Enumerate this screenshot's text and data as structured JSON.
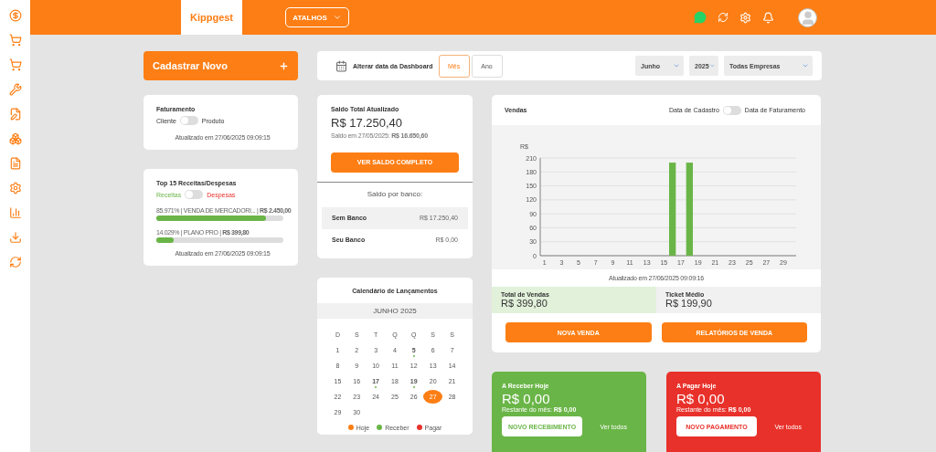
{
  "header": {
    "brand": "Kippgest",
    "shortcuts": "ATALHOS"
  },
  "new_button": {
    "label": "Cadastrar Novo"
  },
  "date_bar": {
    "label": "Alterar data da Dashboard",
    "periods": [
      {
        "label": "Mês",
        "selected": true
      },
      {
        "label": "Ano",
        "selected": false
      }
    ],
    "selects": [
      {
        "value": "Junho"
      },
      {
        "value": "2025"
      },
      {
        "value": "Todas Empresas"
      }
    ]
  },
  "faturamento": {
    "title": "Faturamento",
    "left": "Cliente",
    "right": "Produto",
    "on": false,
    "updated": "Atualizado em 27/06/2025 09:09:15"
  },
  "top15": {
    "title": "Top 15 Receitas/Despesas",
    "left": "Receitas",
    "right": "Despesas",
    "on": false,
    "items": [
      {
        "text": "85.971% | VENDA DE MERCADORI... | **R$ 2.450,00**",
        "level": 0.86
      },
      {
        "text": "14.029% | PLANO PRO | **R$ 399,80**",
        "level": 0.14
      }
    ],
    "updated": "Atualizado em 27/06/2025 09:09:15"
  },
  "saldo": {
    "title": "Saldo Total Atualizado",
    "amount": "R$ 17.250,40",
    "previous": "Saldo em 27/05/2025: **R$ 16.650,60**",
    "button": "VER SALDO COMPLETO",
    "banks_title": "Saldo por banco:",
    "banks": [
      {
        "name": "Sem Banco",
        "value": "R$ 17.250,40"
      },
      {
        "name": "Seu Banco",
        "value": "R$ 0,00"
      }
    ]
  },
  "calendar": {
    "title": "Calendário de Lançamentos",
    "month": "JUNHO 2025",
    "weekdays": [
      "D",
      "S",
      "T",
      "Q",
      "Q",
      "S",
      "S"
    ],
    "weeks": [
      [
        {
          "day": "1",
          "has_entry": false,
          "today": false
        },
        {
          "day": "2",
          "has_entry": false,
          "today": false
        },
        {
          "day": "3",
          "has_entry": false,
          "today": false
        },
        {
          "day": "4",
          "has_entry": false,
          "today": false
        },
        {
          "day": "5",
          "has_entry": true,
          "today": false
        },
        {
          "day": "6",
          "has_entry": false,
          "today": false
        },
        {
          "day": "7",
          "has_entry": false,
          "today": false
        }
      ],
      [
        {
          "day": "8",
          "has_entry": false,
          "today": false
        },
        {
          "day": "9",
          "has_entry": false,
          "today": false
        },
        {
          "day": "10",
          "has_entry": false,
          "today": false
        },
        {
          "day": "11",
          "has_entry": false,
          "today": false
        },
        {
          "day": "12",
          "has_entry": false,
          "today": false
        },
        {
          "day": "13",
          "has_entry": false,
          "today": false
        },
        {
          "day": "14",
          "has_entry": false,
          "today": false
        }
      ],
      [
        {
          "day": "15",
          "has_entry": false,
          "today": false
        },
        {
          "day": "16",
          "has_entry": false,
          "today": false
        },
        {
          "day": "17",
          "has_entry": true,
          "today": false
        },
        {
          "day": "18",
          "has_entry": false,
          "today": false
        },
        {
          "day": "19",
          "has_entry": true,
          "today": false
        },
        {
          "day": "20",
          "has_entry": false,
          "today": false
        },
        {
          "day": "21",
          "has_entry": false,
          "today": false
        }
      ],
      [
        {
          "day": "22",
          "has_entry": false,
          "today": false
        },
        {
          "day": "23",
          "has_entry": false,
          "today": false
        },
        {
          "day": "24",
          "has_entry": false,
          "today": false
        },
        {
          "day": "25",
          "has_entry": false,
          "today": false
        },
        {
          "day": "26",
          "has_entry": false,
          "today": false
        },
        {
          "day": "27",
          "has_entry": false,
          "today": true
        },
        {
          "day": "28",
          "has_entry": false,
          "today": false
        }
      ],
      [
        {
          "day": "29",
          "has_entry": false,
          "today": false
        },
        {
          "day": "30",
          "has_entry": false,
          "today": false
        }
      ]
    ],
    "legend": [
      {
        "label": "Hoje",
        "color": "#fd7e14"
      },
      {
        "label": "Receber",
        "color": "#6ab547"
      },
      {
        "label": "Pagar",
        "color": "#e8312a"
      }
    ]
  },
  "vendas": {
    "title": "Vendas",
    "left": "Data de Cadastro",
    "right": "Data de Faturamento",
    "on": false,
    "chart_data": {
      "type": "bar",
      "ylabel": "R$",
      "x": [
        1,
        2,
        3,
        4,
        5,
        6,
        7,
        8,
        9,
        10,
        11,
        12,
        13,
        14,
        15,
        16,
        17,
        18,
        19,
        20,
        21,
        22,
        23,
        24,
        25,
        26,
        27,
        28,
        29,
        30
      ],
      "values": [
        0,
        0,
        0,
        0,
        0,
        0,
        0,
        0,
        0,
        0,
        0,
        0,
        0,
        0,
        0,
        200,
        0,
        200,
        0,
        0,
        0,
        0,
        0,
        0,
        0,
        0,
        0,
        0,
        0,
        0
      ],
      "xlim": [
        0.5,
        30.5
      ],
      "ylim": [
        0,
        210
      ],
      "yticks": [
        0,
        30,
        60,
        90,
        120,
        150,
        180,
        210
      ],
      "xticks": [
        1,
        3,
        5,
        7,
        9,
        11,
        13,
        15,
        17,
        19,
        21,
        23,
        25,
        27,
        29
      ],
      "grid": true
    },
    "updated": "Atualizado em 27/06/2025 09:09:16",
    "total": {
      "label": "Total de Vendas",
      "value": "R$ 399,80"
    },
    "ticket": {
      "label": "Ticket Médio",
      "value": "R$ 199,90"
    },
    "buttons": [
      "NOVA VENDA",
      "RELATÓRIOS DE VENDA"
    ]
  },
  "today_cards": [
    {
      "title": "A Receber Hoje",
      "amount": "R$ 0,00",
      "remaining": "Restante do mês: **R$ 0,00**",
      "button": "NOVO RECEBIMENTO",
      "link": "Ver todos",
      "color": "#6ab547"
    },
    {
      "title": "A Pagar Hoje",
      "amount": "R$ 0,00",
      "remaining": "Restante do mês: **R$ 0,00**",
      "button": "NOVO PAGAMENTO",
      "link": "Ver todos",
      "color": "#e8312a"
    }
  ]
}
